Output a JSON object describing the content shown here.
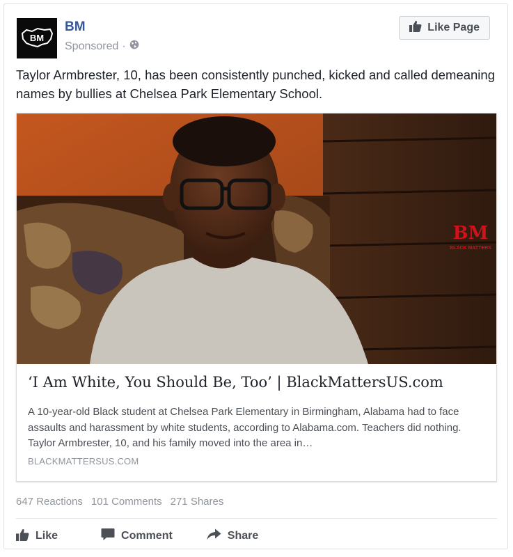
{
  "post": {
    "page_name": "BM",
    "avatar_text": "BM",
    "sponsored": "Sponsored",
    "separator": "·",
    "like_page_label": "Like Page",
    "text": "Taylor Armbrester, 10, has been consistently punched, kicked and called demeaning names by bullies at Chelsea Park Elementary School."
  },
  "link_preview": {
    "image_watermark": "BM",
    "image_watermark_sub": "BLACK MATTERS",
    "title": "‘I Am White, You Should Be, Too’ | BlackMattersUS.com",
    "description": "A 10-year-old Black student at Chelsea Park Elementary in Birmingham, Alabama had to face assaults and harassment by white students, according to Alabama.com. Teachers did nothing. Taylor Armbrester, 10, and his family moved into the area in…",
    "domain": "BLACKMATTERSUS.COM"
  },
  "stats": {
    "reactions": "647 Reactions",
    "comments": "101 Comments",
    "shares": "271 Shares"
  },
  "actions": {
    "like": "Like",
    "comment": "Comment",
    "share": "Share"
  },
  "icons": {
    "globe": "globe-icon",
    "thumbs_up": "thumbs-up-icon",
    "comment": "comment-icon",
    "share": "share-arrow-icon"
  },
  "colors": {
    "page_name": "#365899",
    "muted": "#90949c",
    "watermark_red": "#d0121b"
  }
}
